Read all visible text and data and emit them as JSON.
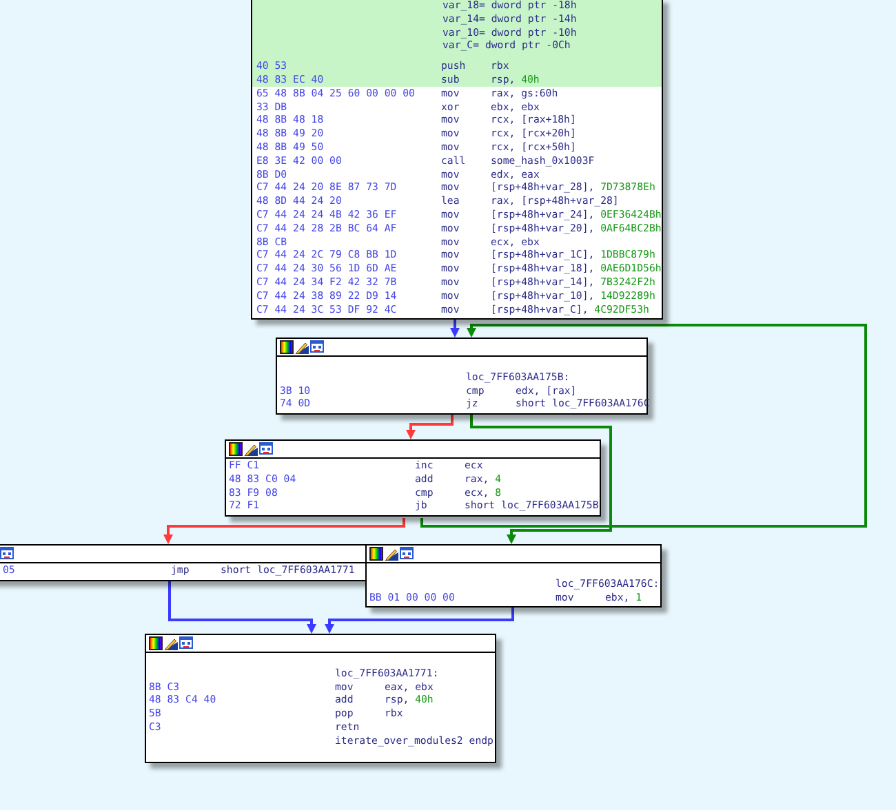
{
  "nodes": [
    {
      "locals": [
        "var_18= dword ptr -18h",
        "var_14= dword ptr -14h",
        "var_10= dword ptr -10h",
        "var_C= dword ptr -0Ch"
      ],
      "instructions": [
        {
          "bytes": "40 53",
          "mnemonic": "push",
          "operand": "rbx",
          "highlighted": true
        },
        {
          "bytes": "48 83 EC 40",
          "mnemonic": "sub",
          "operand": "rsp,",
          "immediate": "40h",
          "highlighted": true
        },
        {
          "bytes": "65 48 8B 04 25 60 00 00 00",
          "mnemonic": "mov",
          "operand": "rax, gs:60h",
          "highlighted": false
        },
        {
          "bytes": "33 DB",
          "mnemonic": "xor",
          "operand": "ebx, ebx",
          "highlighted": false
        },
        {
          "bytes": "48 8B 48 18",
          "mnemonic": "mov",
          "operand": "rcx, [rax+18h]",
          "highlighted": false
        },
        {
          "bytes": "48 8B 49 20",
          "mnemonic": "mov",
          "operand": "rcx, [rcx+20h]",
          "highlighted": false
        },
        {
          "bytes": "48 8B 49 50",
          "mnemonic": "mov",
          "operand": "rcx, [rcx+50h]",
          "highlighted": false
        },
        {
          "bytes": "E8 3E 42 00 00",
          "mnemonic": "call",
          "operand": "some_hash_0x1003F",
          "highlighted": false
        },
        {
          "bytes": "8B D0",
          "mnemonic": "mov",
          "operand": "edx, eax",
          "highlighted": false
        },
        {
          "bytes": "C7 44 24 20 8E 87 73 7D",
          "mnemonic": "mov",
          "operand": "[rsp+48h+var_28],",
          "immediate": "7D73878Eh",
          "highlighted": false
        },
        {
          "bytes": "48 8D 44 24 20",
          "mnemonic": "lea",
          "operand": "rax, [rsp+48h+var_28]",
          "highlighted": false
        },
        {
          "bytes": "C7 44 24 24 4B 42 36 EF",
          "mnemonic": "mov",
          "operand": "[rsp+48h+var_24],",
          "immediate": "0EF36424Bh",
          "highlighted": false
        },
        {
          "bytes": "C7 44 24 28 2B BC 64 AF",
          "mnemonic": "mov",
          "operand": "[rsp+48h+var_20],",
          "immediate": "0AF64BC2Bh",
          "highlighted": false
        },
        {
          "bytes": "8B CB",
          "mnemonic": "mov",
          "operand": "ecx, ebx",
          "highlighted": false
        },
        {
          "bytes": "C7 44 24 2C 79 C8 BB 1D",
          "mnemonic": "mov",
          "operand": "[rsp+48h+var_1C],",
          "immediate": "1DBBC879h",
          "highlighted": false
        },
        {
          "bytes": "C7 44 24 30 56 1D 6D AE",
          "mnemonic": "mov",
          "operand": "[rsp+48h+var_18],",
          "immediate": "0AE6D1D56h",
          "highlighted": false
        },
        {
          "bytes": "C7 44 24 34 F2 42 32 7B",
          "mnemonic": "mov",
          "operand": "[rsp+48h+var_14],",
          "immediate": "7B3242F2h",
          "highlighted": false
        },
        {
          "bytes": "C7 44 24 38 89 22 D9 14",
          "mnemonic": "mov",
          "operand": "[rsp+48h+var_10],",
          "immediate": "14D92289h",
          "highlighted": false
        },
        {
          "bytes": "C7 44 24 3C 53 DF 92 4C",
          "mnemonic": "mov",
          "operand": "[rsp+48h+var_C],",
          "immediate": "4C92DF53h",
          "highlighted": false
        }
      ]
    },
    {
      "label": "loc_7FF603AA175B:",
      "instructions": [
        {
          "bytes": "3B 10",
          "mnemonic": "cmp",
          "operand": "edx, [rax]",
          "highlighted": false
        },
        {
          "bytes": "74 0D",
          "mnemonic": "jz",
          "operand": "short loc_7FF603AA176C",
          "highlighted": false
        }
      ]
    },
    {
      "instructions": [
        {
          "bytes": "FF C1",
          "mnemonic": "inc",
          "operand": "ecx",
          "highlighted": false
        },
        {
          "bytes": "48 83 C0 04",
          "mnemonic": "add",
          "operand": "rax,",
          "immediate": "4",
          "highlighted": false
        },
        {
          "bytes": "83 F9 08",
          "mnemonic": "cmp",
          "operand": "ecx,",
          "immediate": "8",
          "highlighted": false
        },
        {
          "bytes": "72 F1",
          "mnemonic": "jb",
          "operand": "short loc_7FF603AA175B",
          "highlighted": false
        }
      ]
    },
    {
      "instructions": [
        {
          "bytes": "05",
          "mnemonic": "jmp",
          "operand": "short loc_7FF603AA1771",
          "highlighted": false
        }
      ]
    },
    {
      "label": "loc_7FF603AA176C:",
      "instructions": [
        {
          "bytes": "BB 01 00 00 00",
          "mnemonic": "mov",
          "operand": "ebx,",
          "immediate": "1",
          "highlighted": false
        }
      ]
    },
    {
      "label": "loc_7FF603AA1771:",
      "instructions": [
        {
          "bytes": "8B C3",
          "mnemonic": "mov",
          "operand": "eax, ebx",
          "highlighted": false
        },
        {
          "bytes": "48 83 C4 40",
          "mnemonic": "add",
          "operand": "rsp,",
          "immediate": "40h",
          "highlighted": false
        },
        {
          "bytes": "5B",
          "mnemonic": "pop",
          "operand": "rbx",
          "highlighted": false
        },
        {
          "bytes": "C3",
          "mnemonic": "retn",
          "highlighted": false
        }
      ],
      "footer": "iterate_over_modules2 endp"
    }
  ],
  "edges": [
    {
      "kind": "unconditional"
    },
    {
      "kind": "not_taken"
    },
    {
      "kind": "taken"
    },
    {
      "kind": "taken"
    },
    {
      "kind": "not_taken"
    },
    {
      "kind": "unconditional"
    },
    {
      "kind": "unconditional"
    }
  ]
}
